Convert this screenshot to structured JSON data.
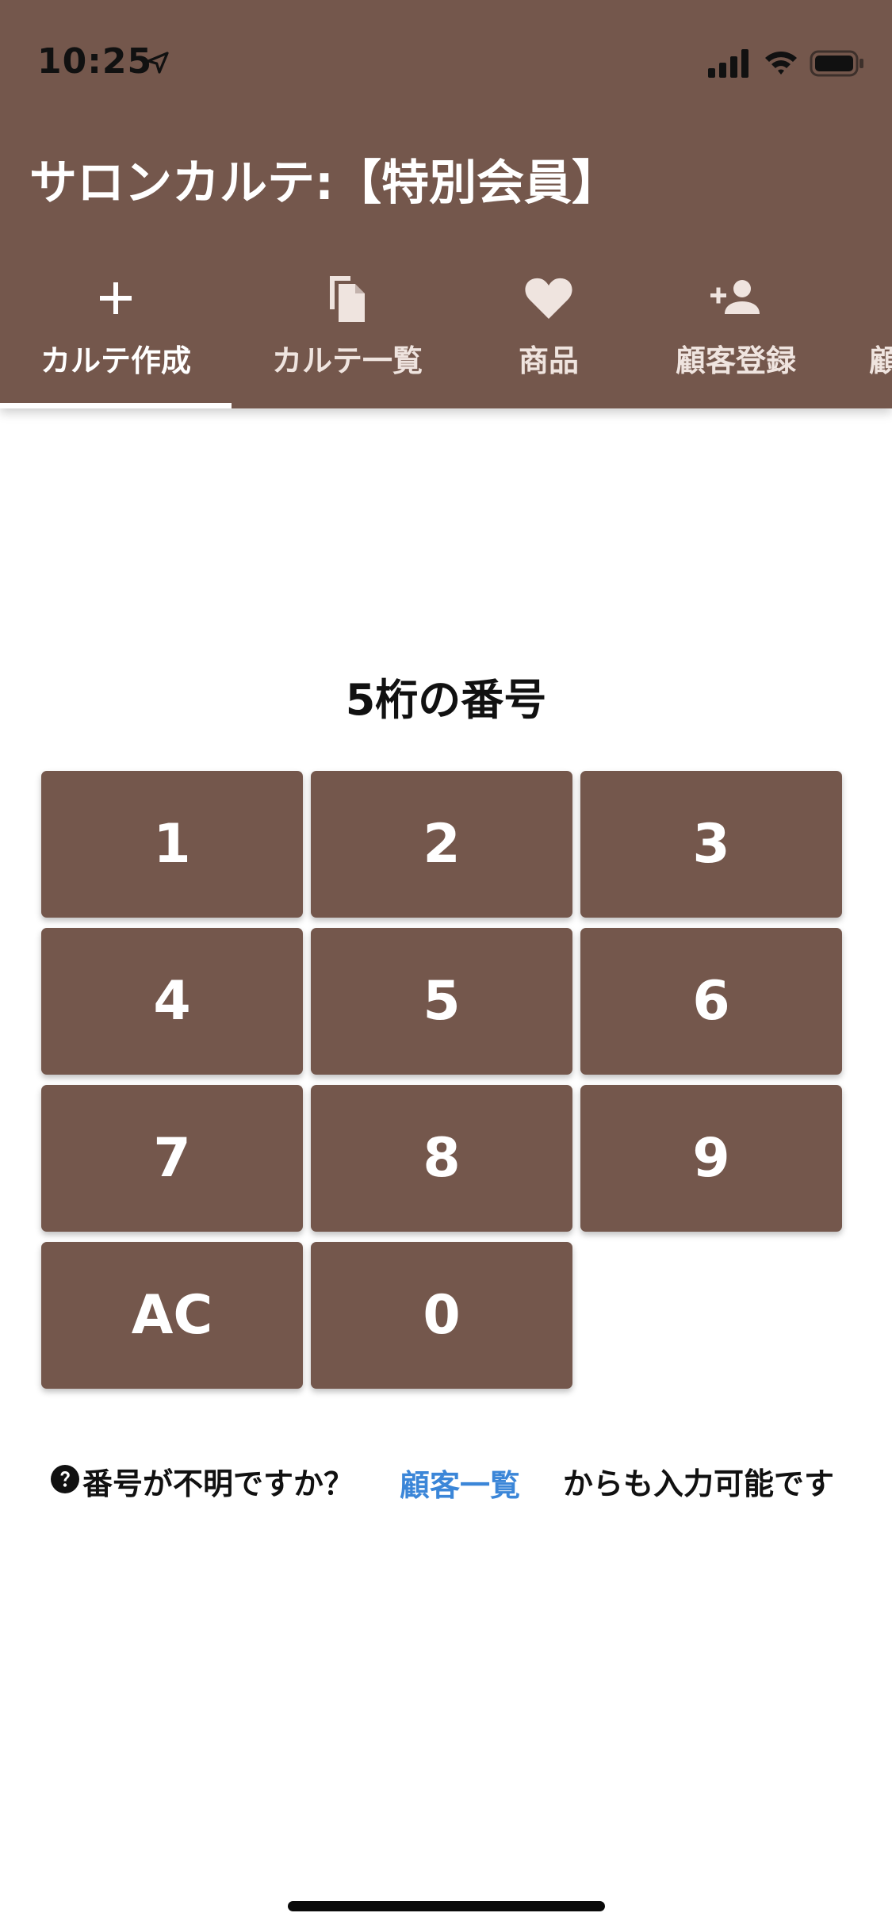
{
  "status_bar": {
    "time": "10:25",
    "icons": [
      "location-arrow-icon",
      "cellular-signal-icon",
      "wifi-icon",
      "battery-icon"
    ]
  },
  "app": {
    "title": "サロンカルテ:【特別会員】"
  },
  "tabs": [
    {
      "label": "カルテ作成",
      "icon": "plus-icon",
      "selected": true
    },
    {
      "label": "カルテ一覧",
      "icon": "copy-document-icon",
      "selected": false
    },
    {
      "label": "商品",
      "icon": "heart-icon",
      "selected": false
    },
    {
      "label": "顧客登録",
      "icon": "person-add-icon",
      "selected": false
    },
    {
      "label": "顧",
      "icon": "",
      "selected": false
    }
  ],
  "keypad": {
    "title": "5桁の番号",
    "keys": [
      "1",
      "2",
      "3",
      "4",
      "5",
      "6",
      "7",
      "8",
      "9",
      "AC",
      "0"
    ]
  },
  "help": {
    "icon": "question-circle-icon",
    "text": "番号が不明ですか？",
    "link": "顧客一覧",
    "suffix": "からも入力可能です"
  },
  "colors": {
    "primary": "#74574c",
    "link": "#3b86d8",
    "indicator": "#ffffff"
  }
}
